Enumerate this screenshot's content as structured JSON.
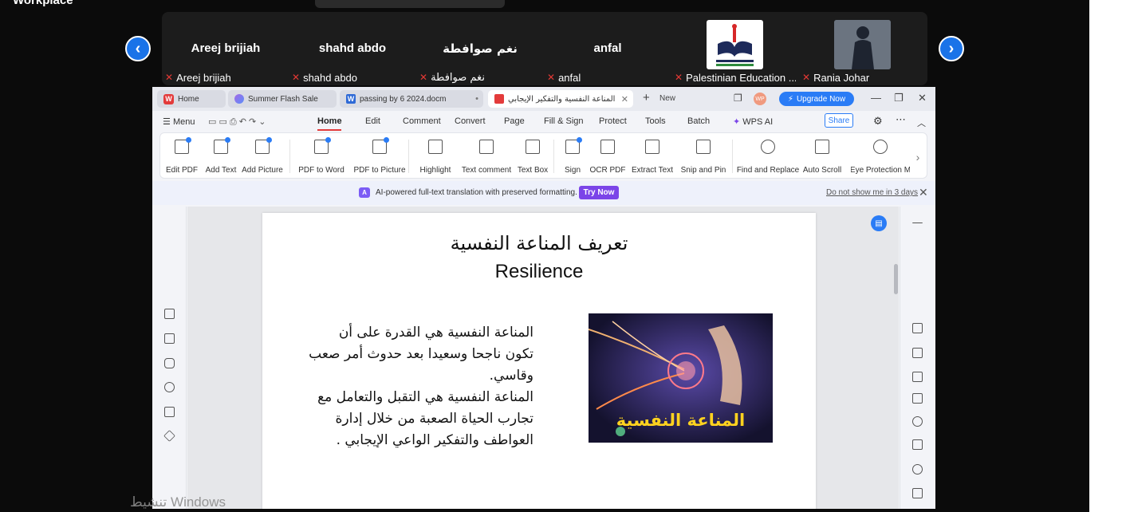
{
  "meeting": {
    "app_label": "Workplace",
    "participants": [
      {
        "name": "Areej brijiah",
        "label": "Areej brijiah"
      },
      {
        "name": "shahd abdo",
        "label": "shahd abdo"
      },
      {
        "name": "نغم صوافطة",
        "label": "نغم صوافطة"
      },
      {
        "name": "anfal",
        "label": "anfal"
      },
      {
        "name": "",
        "label": "Palestinian Education ..."
      },
      {
        "name": "",
        "label": "Rania Johar"
      }
    ]
  },
  "wps": {
    "tabs": [
      {
        "label": "Home"
      },
      {
        "label": "Summer Flash Sale"
      },
      {
        "label": "passing by 6 2024.docm"
      },
      {
        "label": "المناعة النفسية والتفكير الإيجابي"
      }
    ],
    "new_tab": "New",
    "upgrade": "Upgrade Now",
    "avatar": "WP",
    "menu": {
      "menu_label": "Menu",
      "items": [
        "Home",
        "Edit",
        "Comment",
        "Convert",
        "Page",
        "Fill & Sign",
        "Protect",
        "Tools",
        "Batch",
        "WPS AI"
      ],
      "share": "Share"
    },
    "ribbon": [
      "Edit PDF",
      "Add Text",
      "Add Picture",
      "PDF to Word",
      "PDF to Picture",
      "Highlight",
      "Text comment",
      "Text Box",
      "Sign",
      "OCR PDF",
      "Extract Text",
      "Snip and Pin",
      "Find and Replace",
      "Auto Scroll",
      "Eye Protection M"
    ],
    "banner": {
      "text": "AI-powered full-text translation with preserved formatting.",
      "try_now": "Try Now",
      "dismiss": "Do not show me in 3 days"
    }
  },
  "document": {
    "title_ar": "تعريف المناعة النفسية",
    "title_en": "Resilience",
    "para1": "المناعة النفسية هي القدرة على أن تكون ناجحا وسعيدا بعد حدوث أمر صعب وقاسي.",
    "para2": "المناعة النفسية هي التقبل والتعامل مع تجارب الحياة الصعبة من خلال إدارة العواطف والتفكير الواعي الإيجابي .",
    "image_caption": "المناعة النفسية"
  },
  "watermark": "تنشيط Windows",
  "colors": {
    "accent": "#2a7cf6",
    "wps_red": "#e33b3b",
    "zoom_blue": "#1a73e8"
  }
}
